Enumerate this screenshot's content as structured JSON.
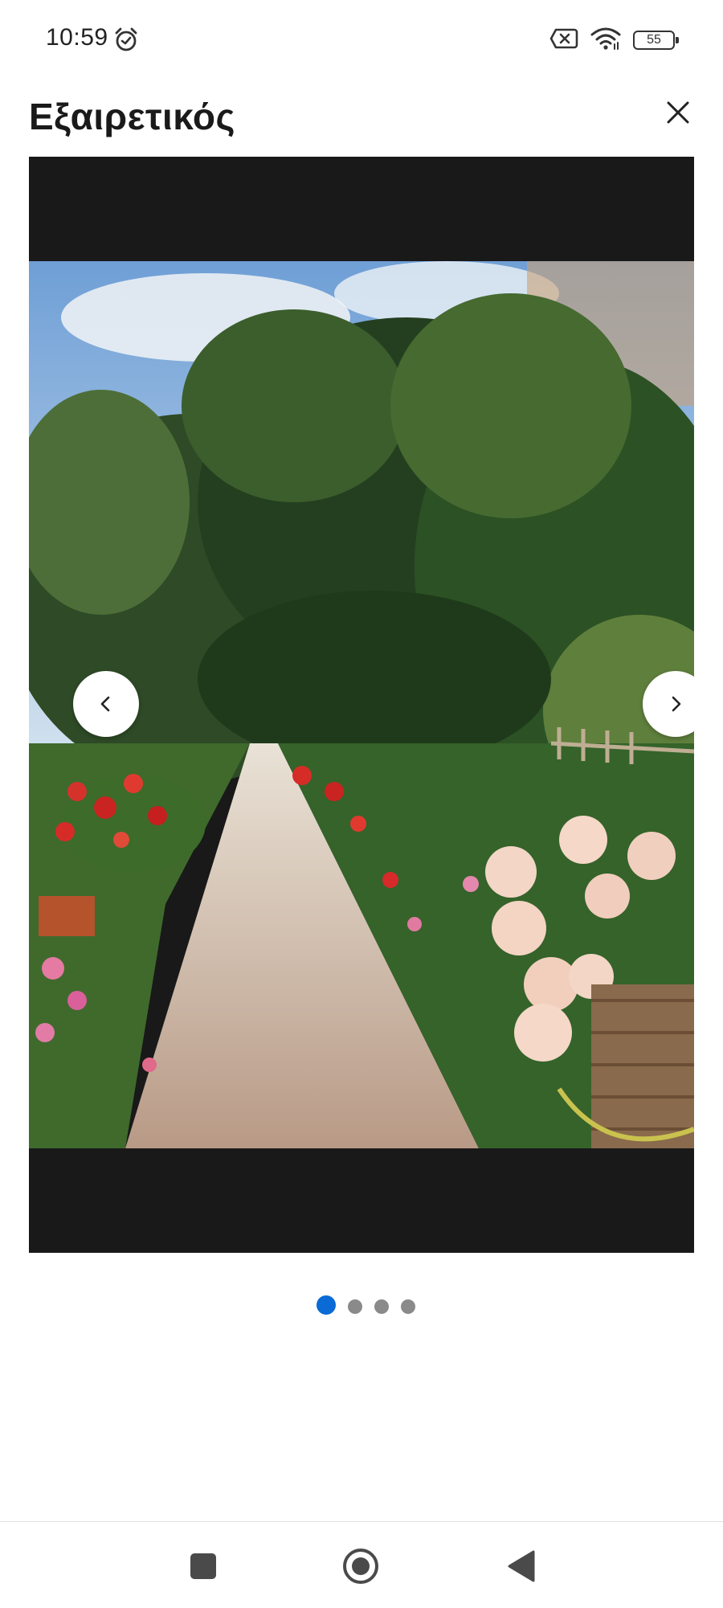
{
  "status_bar": {
    "time": "10:59",
    "battery": "55",
    "icons": [
      "alarm-clock-icon",
      "no-sim-icon",
      "wifi-icon",
      "battery-icon"
    ]
  },
  "header": {
    "title": "Εξαιρετικός",
    "close_icon": "close-icon"
  },
  "gallery": {
    "image_description_hidden": false,
    "total_images": 4,
    "current_index": 0,
    "prev_icon": "chevron-left-icon",
    "next_icon": "chevron-right-icon",
    "dots": [
      {
        "active": true
      },
      {
        "active": false
      },
      {
        "active": false
      },
      {
        "active": false
      }
    ]
  },
  "colors": {
    "accent": "#0a6ad6",
    "viewer_bg": "#191919",
    "dot_inactive": "#8a8a8a"
  },
  "system_nav": {
    "icons": [
      "recents-square-icon",
      "home-circle-icon",
      "back-triangle-icon"
    ]
  }
}
